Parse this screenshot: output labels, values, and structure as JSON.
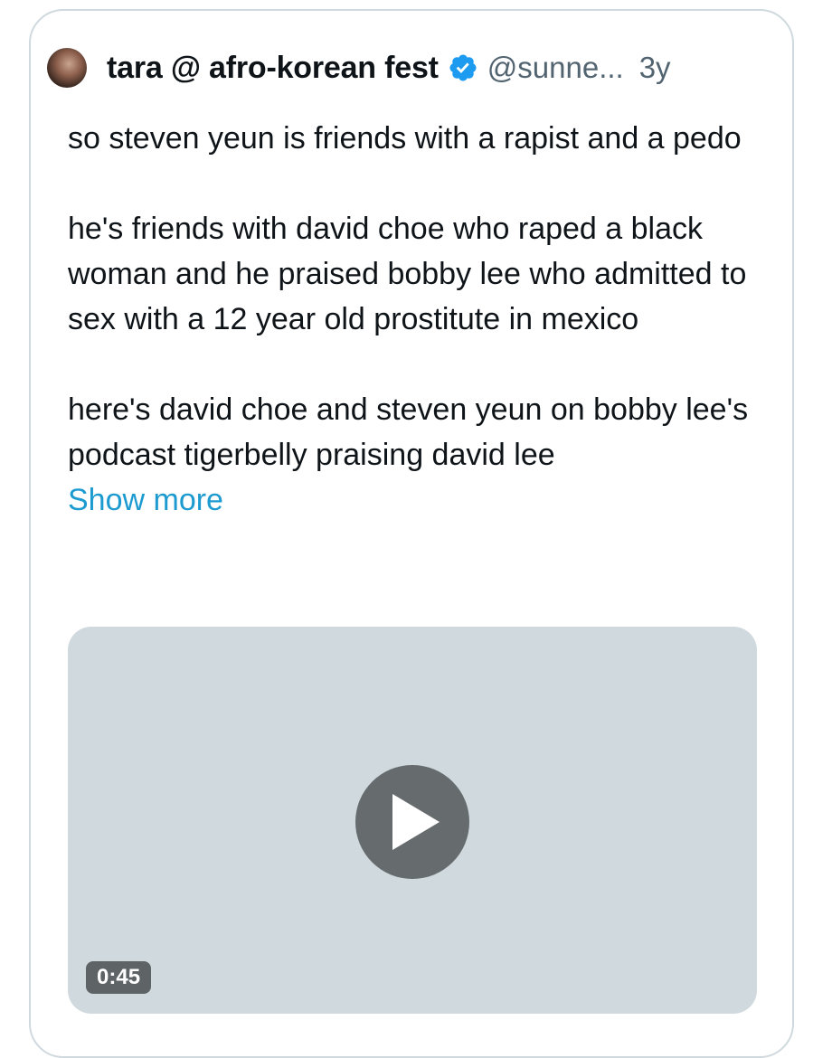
{
  "tweet": {
    "author": {
      "display_name": "tara @ afro-korean fest",
      "handle": "@sunne...",
      "verified": true,
      "avatar_icon": "avatar-photo"
    },
    "separator": "·",
    "time_ago": "3y",
    "text": {
      "paragraph_1": "so steven yeun is friends with a rapist and a pedo",
      "paragraph_2": "he's friends with david choe who raped a black woman and he praised bobby lee who admitted to sex with a 12 year old prostitute in mexico",
      "paragraph_3": "here's david choe and steven yeun on bobby lee's podcast tigerbelly praising david lee"
    },
    "show_more_label": "Show more",
    "media": {
      "type": "video",
      "duration": "0:45",
      "play_icon": "play-icon"
    }
  },
  "colors": {
    "text_primary": "#0f1419",
    "text_secondary": "#536471",
    "link": "#1d9bd0",
    "verified_badge": "#1d9bf0",
    "border": "#cfd9de",
    "media_background": "#cfd9de",
    "play_button": "#666b6e"
  }
}
